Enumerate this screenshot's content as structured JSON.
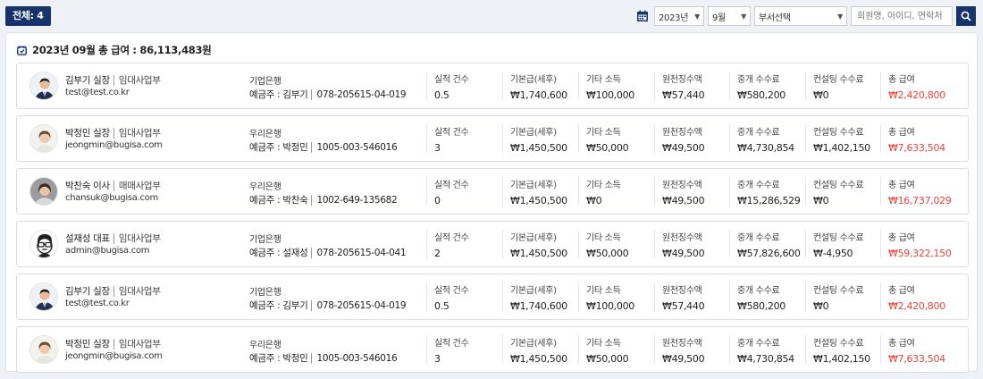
{
  "header": {
    "total_label": "전체: 4",
    "year_select": "2023년",
    "month_select": "9월",
    "dept_select": "부서선택",
    "search_placeholder": "회원명, 아이디, 연락처"
  },
  "summary": {
    "text": "2023년 09월 총 급여 : 86,113,483원"
  },
  "column_labels": {
    "count": "실적 건수",
    "base": "기본급(세후)",
    "other": "기타 소득",
    "withholding": "원천징수액",
    "brokerage": "중개 수수료",
    "consulting": "컨설팅 수수료",
    "total": "총 급여"
  },
  "rows": [
    {
      "avatar": "suit-man",
      "name": "김부기 실장",
      "dept": "임대사업부",
      "email": "test@test.co.kr",
      "bank": "기업은행",
      "holder": "예금주 : 김부기",
      "account": "078-205615-04-019",
      "count": "0.5",
      "base": "₩1,740,600",
      "other": "₩100,000",
      "withholding": "₩57,440",
      "brokerage": "₩580,200",
      "consulting": "₩0",
      "total": "₩2,420,800"
    },
    {
      "avatar": "woman",
      "name": "박정민 실장",
      "dept": "임대사업부",
      "email": "jeongmin@bugisa.com",
      "bank": "우리은행",
      "holder": "예금주 : 박정민",
      "account": "1005-003-546016",
      "count": "3",
      "base": "₩1,450,500",
      "other": "₩50,000",
      "withholding": "₩49,500",
      "brokerage": "₩4,730,854",
      "consulting": "₩1,402,150",
      "total": "₩7,633,504"
    },
    {
      "avatar": "woman-dark",
      "name": "박찬숙 이사",
      "dept": "매매사업부",
      "email": "chansuk@bugisa.com",
      "bank": "우리은행",
      "holder": "예금주 : 박찬숙",
      "account": "1002-649-135682",
      "count": "0",
      "base": "₩1,450,500",
      "other": "₩0",
      "withholding": "₩49,500",
      "brokerage": "₩15,286,529",
      "consulting": "₩0",
      "total": "₩16,737,029"
    },
    {
      "avatar": "cartoon",
      "name": "설재성 대표",
      "dept": "임대사업부",
      "email": "admin@bugisa.com",
      "bank": "기업은행",
      "holder": "예금주 : 설재성",
      "account": "078-205615-04-041",
      "count": "2",
      "base": "₩1,450,500",
      "other": "₩50,000",
      "withholding": "₩49,500",
      "brokerage": "₩57,826,600",
      "consulting": "₩-4,950",
      "total": "₩59,322,150"
    },
    {
      "avatar": "suit-man",
      "name": "김부기 실장",
      "dept": "임대사업부",
      "email": "test@test.co.kr",
      "bank": "기업은행",
      "holder": "예금주 : 김부기",
      "account": "078-205615-04-019",
      "count": "0.5",
      "base": "₩1,740,600",
      "other": "₩100,000",
      "withholding": "₩57,440",
      "brokerage": "₩580,200",
      "consulting": "₩0",
      "total": "₩2,420,800"
    },
    {
      "avatar": "woman",
      "name": "박정민 실장",
      "dept": "임대사업부",
      "email": "jeongmin@bugisa.com",
      "bank": "우리은행",
      "holder": "예금주 : 박정민",
      "account": "1005-003-546016",
      "count": "3",
      "base": "₩1,450,500",
      "other": "₩50,000",
      "withholding": "₩49,500",
      "brokerage": "₩4,730,854",
      "consulting": "₩1,402,150",
      "total": "₩7,633,504"
    }
  ],
  "colors": {
    "accent": "#16336b",
    "total_red": "#e8473d"
  },
  "icons": {
    "calendar": "calendar-icon",
    "search": "search-icon",
    "summary": "wallet-icon"
  }
}
